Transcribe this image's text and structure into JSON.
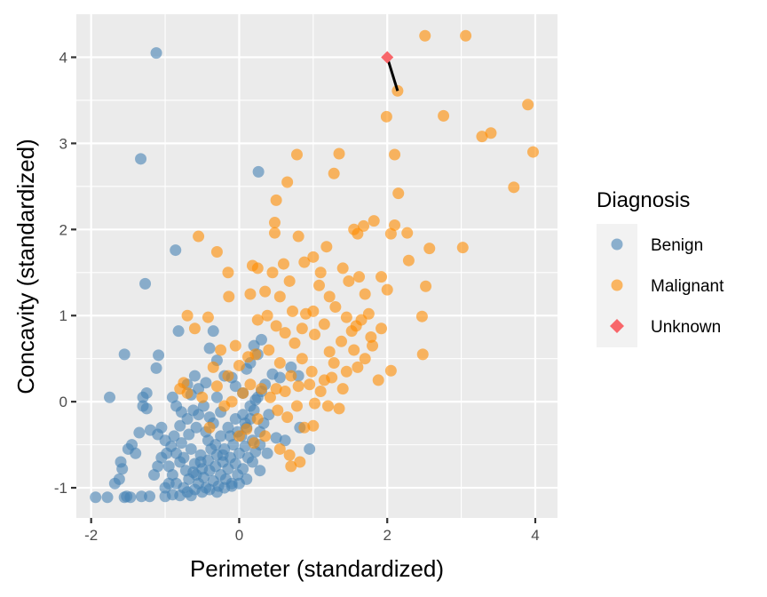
{
  "chart_data": {
    "type": "scatter",
    "title": "",
    "xlabel": "Perimeter (standardized)",
    "ylabel": "Concavity (standardized)",
    "xlim": [
      -2.2,
      4.3
    ],
    "ylim": [
      -1.35,
      4.5
    ],
    "x_ticks": [
      -2,
      0,
      2,
      4
    ],
    "y_ticks": [
      -1,
      0,
      1,
      2,
      3,
      4
    ],
    "x_tick_labels": [
      "-2",
      "0",
      "2",
      "4"
    ],
    "y_tick_labels": [
      "-1",
      "0",
      "1",
      "2",
      "3",
      "4"
    ],
    "grid": true,
    "legend": {
      "title": "Diagnosis",
      "position": "right",
      "entries": [
        {
          "label": "Benign",
          "color": "#4682B4",
          "shape": "circle"
        },
        {
          "label": "Malignant",
          "color": "#FF8C00",
          "shape": "circle"
        },
        {
          "label": "Unknown",
          "color": "#F8666A",
          "shape": "diamond"
        }
      ]
    },
    "colors": {
      "panel_bg": "#EBEBEB",
      "grid_major": "#FFFFFF",
      "benign": "#4682B4",
      "malignant": "#FF8C00",
      "unknown": "#F8666A",
      "neighbor_line": "#000000",
      "legend_key_bg": "#F2F2F2"
    },
    "point_alpha": 0.6,
    "series": [
      {
        "name": "Benign",
        "points": [
          [
            -1.12,
            4.05
          ],
          [
            -1.33,
            2.82
          ],
          [
            0.26,
            2.67
          ],
          [
            -0.86,
            1.76
          ],
          [
            -1.27,
            1.37
          ],
          [
            -1.55,
            0.55
          ],
          [
            -1.09,
            0.54
          ],
          [
            -1.12,
            0.39
          ],
          [
            -1.75,
            0.05
          ],
          [
            -1.3,
            0.05
          ],
          [
            -1.3,
            -0.05
          ],
          [
            -1.25,
            0.1
          ],
          [
            -1.25,
            -0.08
          ],
          [
            -1.94,
            -1.11
          ],
          [
            -1.78,
            -1.11
          ],
          [
            -1.55,
            -1.11
          ],
          [
            -1.47,
            -1.11
          ],
          [
            -1.52,
            -1.1
          ],
          [
            -1.32,
            -1.1
          ],
          [
            -1.21,
            -1.1
          ],
          [
            -1.0,
            -1.1
          ],
          [
            -0.9,
            -1.08
          ],
          [
            -0.8,
            -1.09
          ],
          [
            -0.65,
            -1.09
          ],
          [
            -1.62,
            -0.9
          ],
          [
            -1.58,
            -0.78
          ],
          [
            -1.6,
            -0.7
          ],
          [
            -1.68,
            -0.95
          ],
          [
            -1.5,
            -0.55
          ],
          [
            -1.45,
            -0.5
          ],
          [
            -1.4,
            -0.6
          ],
          [
            -1.35,
            -0.36
          ],
          [
            -1.2,
            -0.33
          ],
          [
            -1.1,
            -0.38
          ],
          [
            -1.05,
            -0.3
          ],
          [
            -0.98,
            -0.6
          ],
          [
            -0.92,
            -0.52
          ],
          [
            -0.88,
            -0.4
          ],
          [
            -0.8,
            -0.28
          ],
          [
            -0.7,
            -0.2
          ],
          [
            -0.62,
            -0.1
          ],
          [
            -0.55,
            -0.15
          ],
          [
            -0.48,
            -0.05
          ],
          [
            -0.4,
            -0.18
          ],
          [
            -0.3,
            0.05
          ],
          [
            -0.25,
            -0.12
          ],
          [
            -0.95,
            -0.75
          ],
          [
            -0.9,
            -0.85
          ],
          [
            -0.85,
            -0.95
          ],
          [
            -0.8,
            -0.7
          ],
          [
            -0.75,
            -0.65
          ],
          [
            -0.72,
            -0.8
          ],
          [
            -0.68,
            -0.9
          ],
          [
            -0.65,
            -0.55
          ],
          [
            -0.6,
            -0.72
          ],
          [
            -0.58,
            -0.85
          ],
          [
            -0.55,
            -0.95
          ],
          [
            -0.52,
            -0.62
          ],
          [
            -0.5,
            -0.78
          ],
          [
            -0.48,
            -0.88
          ],
          [
            -0.45,
            -1.0
          ],
          [
            -0.42,
            -0.68
          ],
          [
            -0.4,
            -0.8
          ],
          [
            -0.38,
            -0.55
          ],
          [
            -0.35,
            -0.92
          ],
          [
            -0.32,
            -0.75
          ],
          [
            -0.3,
            -0.62
          ],
          [
            -0.28,
            -0.98
          ],
          [
            -0.25,
            -0.85
          ],
          [
            -0.22,
            -0.7
          ],
          [
            -0.2,
            -0.55
          ],
          [
            -0.18,
            -0.9
          ],
          [
            -0.15,
            -0.78
          ],
          [
            -0.12,
            -0.65
          ],
          [
            -0.1,
            -0.95
          ],
          [
            -0.08,
            -0.5
          ],
          [
            -0.05,
            -0.72
          ],
          [
            -0.02,
            -0.85
          ],
          [
            0.0,
            -0.6
          ],
          [
            0.03,
            -0.4
          ],
          [
            0.05,
            -0.78
          ],
          [
            0.08,
            -0.52
          ],
          [
            0.1,
            -0.3
          ],
          [
            0.12,
            -0.65
          ],
          [
            0.15,
            -0.2
          ],
          [
            0.18,
            -0.45
          ],
          [
            0.2,
            -0.1
          ],
          [
            0.22,
            -0.58
          ],
          [
            0.25,
            0.05
          ],
          [
            0.28,
            -0.35
          ],
          [
            0.3,
            0.12
          ],
          [
            0.33,
            -0.25
          ],
          [
            0.35,
            0.2
          ],
          [
            0.4,
            -0.15
          ],
          [
            0.45,
            0.32
          ],
          [
            0.5,
            -0.42
          ],
          [
            0.55,
            0.28
          ],
          [
            0.62,
            -0.45
          ],
          [
            0.7,
            0.4
          ],
          [
            0.8,
            0.3
          ],
          [
            0.82,
            -0.3
          ],
          [
            0.95,
            -0.55
          ],
          [
            -0.82,
            0.82
          ],
          [
            -0.35,
            0.82
          ],
          [
            0.2,
            0.65
          ],
          [
            0.3,
            0.72
          ],
          [
            -0.4,
            0.62
          ],
          [
            -0.3,
            0.48
          ],
          [
            -0.1,
            0.28
          ],
          [
            -0.05,
            0.18
          ],
          [
            0.05,
            0.1
          ],
          [
            -0.7,
            0.2
          ],
          [
            -0.6,
            0.3
          ],
          [
            -0.85,
            -0.05
          ],
          [
            -0.78,
            -0.12
          ],
          [
            -0.9,
            0.05
          ],
          [
            -0.65,
            0.08
          ],
          [
            -0.55,
            0.15
          ],
          [
            -0.45,
            0.22
          ],
          [
            -0.2,
            0.3
          ],
          [
            0.1,
            0.38
          ],
          [
            0.15,
            0.45
          ],
          [
            0.25,
            0.55
          ],
          [
            -0.75,
            -1.0
          ],
          [
            -0.7,
            -1.05
          ],
          [
            -0.6,
            -1.02
          ],
          [
            -0.5,
            -1.05
          ],
          [
            -0.4,
            -1.02
          ],
          [
            -0.3,
            -1.05
          ],
          [
            -0.2,
            -1.0
          ],
          [
            -0.1,
            -0.98
          ],
          [
            0.0,
            -0.95
          ],
          [
            0.1,
            -0.9
          ],
          [
            -1.0,
            -0.45
          ],
          [
            -1.05,
            -0.65
          ],
          [
            -1.1,
            -0.75
          ],
          [
            -1.15,
            -0.85
          ],
          [
            -0.95,
            -0.95
          ],
          [
            -1.0,
            -1.0
          ],
          [
            -0.85,
            -0.6
          ],
          [
            -0.78,
            -0.48
          ],
          [
            -0.68,
            -0.38
          ],
          [
            -0.58,
            -0.3
          ],
          [
            -0.45,
            -0.35
          ],
          [
            -0.35,
            -0.25
          ],
          [
            -0.25,
            -0.4
          ],
          [
            -0.15,
            -0.3
          ],
          [
            -0.05,
            -0.2
          ],
          [
            0.05,
            -0.15
          ],
          [
            0.15,
            -0.05
          ],
          [
            0.22,
            0.02
          ],
          [
            0.28,
            -0.5
          ],
          [
            0.38,
            -0.6
          ],
          [
            -0.62,
            -0.82
          ],
          [
            -0.52,
            -0.7
          ],
          [
            -0.42,
            -0.45
          ],
          [
            -0.32,
            -0.5
          ],
          [
            -0.22,
            -0.62
          ],
          [
            -0.12,
            -0.4
          ],
          [
            -0.02,
            -0.35
          ],
          [
            0.08,
            -0.25
          ],
          [
            0.18,
            -0.7
          ],
          [
            0.28,
            -0.8
          ]
        ]
      },
      {
        "name": "Malignant",
        "points": [
          [
            2.51,
            4.25
          ],
          [
            3.06,
            4.25
          ],
          [
            2.14,
            3.61
          ],
          [
            1.99,
            3.31
          ],
          [
            2.76,
            3.32
          ],
          [
            3.9,
            3.45
          ],
          [
            3.28,
            3.08
          ],
          [
            3.4,
            3.12
          ],
          [
            3.97,
            2.9
          ],
          [
            3.71,
            2.49
          ],
          [
            3.02,
            1.79
          ],
          [
            0.78,
            2.87
          ],
          [
            1.35,
            2.88
          ],
          [
            0.65,
            2.55
          ],
          [
            1.28,
            2.65
          ],
          [
            2.1,
            2.87
          ],
          [
            2.15,
            2.42
          ],
          [
            2.27,
            1.96
          ],
          [
            2.1,
            2.05
          ],
          [
            2.05,
            1.95
          ],
          [
            2.57,
            1.78
          ],
          [
            2.29,
            1.64
          ],
          [
            2.52,
            1.34
          ],
          [
            2.47,
            0.99
          ],
          [
            2.48,
            0.55
          ],
          [
            0.5,
            2.34
          ],
          [
            0.48,
            2.08
          ],
          [
            0.48,
            1.96
          ],
          [
            -0.55,
            1.92
          ],
          [
            -0.3,
            1.74
          ],
          [
            0.8,
            1.92
          ],
          [
            1.68,
            2.04
          ],
          [
            1.82,
            2.1
          ],
          [
            1.6,
            1.95
          ],
          [
            1.55,
            2.0
          ],
          [
            1.18,
            1.8
          ],
          [
            1.0,
            1.68
          ],
          [
            -0.15,
            1.5
          ],
          [
            0.18,
            1.58
          ],
          [
            0.25,
            1.55
          ],
          [
            0.6,
            1.6
          ],
          [
            0.45,
            1.5
          ],
          [
            0.88,
            1.62
          ],
          [
            1.1,
            1.5
          ],
          [
            1.4,
            1.55
          ],
          [
            1.48,
            1.4
          ],
          [
            1.62,
            1.45
          ],
          [
            1.7,
            1.25
          ],
          [
            1.92,
            1.45
          ],
          [
            2.0,
            1.3
          ],
          [
            -0.7,
            1.0
          ],
          [
            -0.42,
            0.98
          ],
          [
            -0.14,
            1.22
          ],
          [
            0.15,
            1.25
          ],
          [
            0.35,
            1.28
          ],
          [
            0.55,
            1.22
          ],
          [
            0.68,
            1.4
          ],
          [
            0.9,
            1.02
          ],
          [
            1.0,
            1.05
          ],
          [
            1.15,
            0.9
          ],
          [
            1.3,
            1.1
          ],
          [
            1.45,
            0.98
          ],
          [
            1.58,
            0.88
          ],
          [
            -0.6,
            0.85
          ],
          [
            -0.25,
            0.6
          ],
          [
            -0.05,
            0.65
          ],
          [
            0.25,
            0.95
          ],
          [
            0.38,
            1.0
          ],
          [
            0.5,
            0.88
          ],
          [
            0.62,
            0.8
          ],
          [
            0.75,
            0.68
          ],
          [
            0.85,
            0.5
          ],
          [
            1.02,
            0.78
          ],
          [
            1.22,
            0.58
          ],
          [
            1.38,
            0.7
          ],
          [
            1.55,
            0.6
          ],
          [
            1.78,
            0.75
          ],
          [
            1.92,
            0.85
          ],
          [
            1.7,
            0.5
          ],
          [
            1.6,
            0.4
          ],
          [
            1.45,
            0.35
          ],
          [
            1.25,
            0.28
          ],
          [
            1.1,
            0.12
          ],
          [
            1.35,
            -0.08
          ],
          [
            1.2,
            -0.05
          ],
          [
            1.0,
            -0.28
          ],
          [
            1.02,
            -0.02
          ],
          [
            0.95,
            0.2
          ],
          [
            2.05,
            0.36
          ],
          [
            1.88,
            0.25
          ],
          [
            -0.75,
            0.22
          ],
          [
            -0.35,
            0.4
          ],
          [
            -0.3,
            0.18
          ],
          [
            -0.15,
            0.3
          ],
          [
            0.0,
            0.42
          ],
          [
            0.12,
            0.52
          ],
          [
            0.22,
            0.55
          ],
          [
            0.4,
            0.6
          ],
          [
            0.55,
            0.45
          ],
          [
            0.7,
            0.3
          ],
          [
            0.8,
            0.18
          ],
          [
            0.5,
            0.15
          ],
          [
            0.62,
            0.12
          ],
          [
            0.3,
            0.15
          ],
          [
            0.42,
            0.05
          ],
          [
            0.52,
            -0.1
          ],
          [
            0.65,
            -0.18
          ],
          [
            0.78,
            -0.05
          ],
          [
            0.88,
            -0.3
          ],
          [
            0.55,
            -0.55
          ],
          [
            0.68,
            -0.62
          ],
          [
            0.82,
            -0.7
          ],
          [
            0.35,
            -0.4
          ],
          [
            0.25,
            -0.2
          ],
          [
            -0.8,
            0.15
          ],
          [
            -0.7,
            0.1
          ],
          [
            -0.5,
            0.05
          ],
          [
            -0.2,
            -0.05
          ],
          [
            -0.1,
            0.0
          ],
          [
            0.05,
            0.1
          ],
          [
            0.15,
            0.2
          ],
          [
            -0.4,
            -0.3
          ],
          [
            0.0,
            -0.4
          ],
          [
            0.1,
            -0.32
          ],
          [
            0.2,
            -0.48
          ],
          [
            0.7,
            -0.75
          ],
          [
            1.15,
            0.25
          ],
          [
            1.28,
            0.45
          ],
          [
            1.4,
            0.15
          ],
          [
            1.52,
            0.82
          ],
          [
            1.65,
            0.95
          ],
          [
            1.75,
            1.02
          ],
          [
            1.8,
            0.65
          ],
          [
            0.98,
            0.35
          ],
          [
            0.85,
            0.85
          ],
          [
            0.72,
            1.05
          ],
          [
            1.08,
            1.35
          ],
          [
            1.22,
            1.22
          ]
        ]
      },
      {
        "name": "Unknown",
        "points": [
          [
            2.0,
            4.0
          ]
        ]
      }
    ],
    "annotations": [
      {
        "type": "segment",
        "from": [
          2.0,
          4.0
        ],
        "to": [
          2.14,
          3.61
        ],
        "color": "#000000",
        "description": "nearest neighbor line"
      }
    ]
  }
}
